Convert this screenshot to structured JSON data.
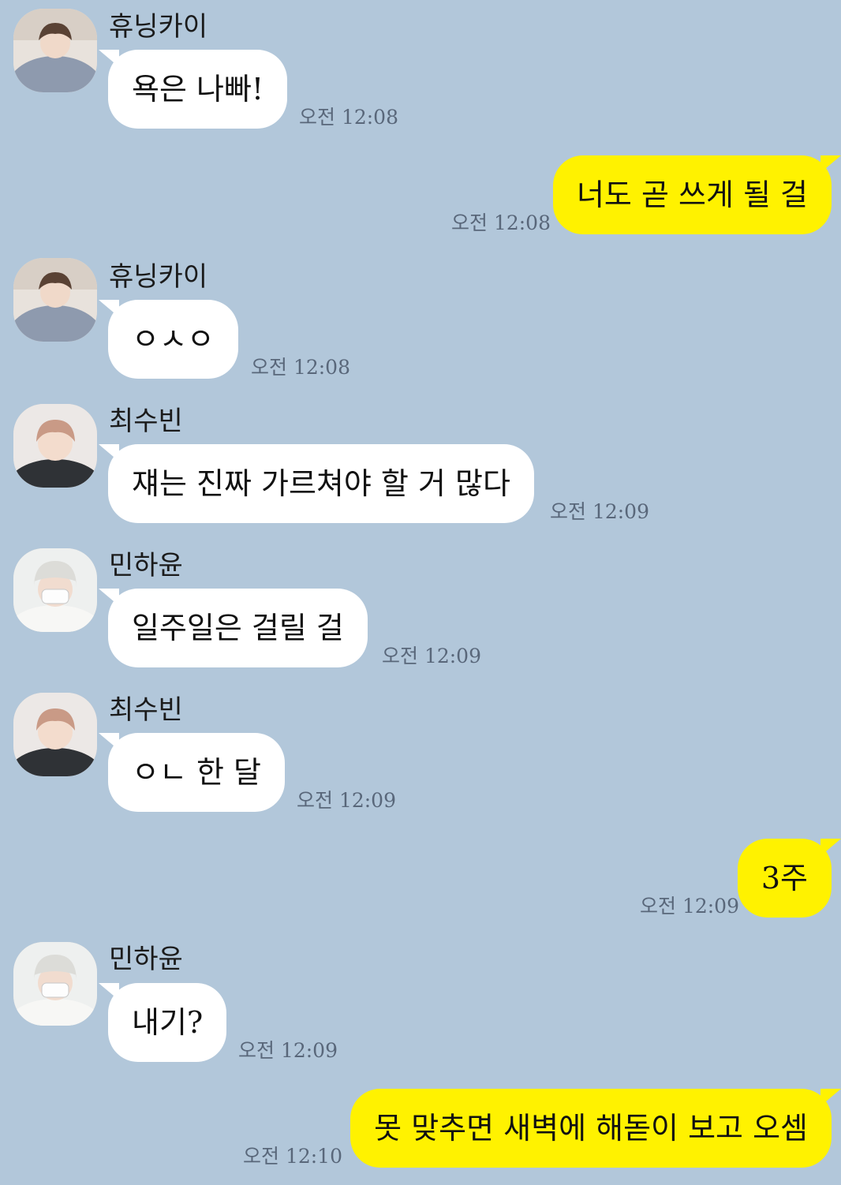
{
  "chat": {
    "messages": [
      {
        "sender": "휴닝카이",
        "text": "욕은 나빠!",
        "time": "오전 12:08",
        "avatar": "avatar-hueningkai"
      },
      {
        "sender": "",
        "text": "너도 곧 쓰게 될 걸",
        "time": "오전 12:08",
        "mine": true
      },
      {
        "sender": "휴닝카이",
        "text": "ㅇㅅㅇ",
        "time": "오전 12:08",
        "avatar": "avatar-hueningkai"
      },
      {
        "sender": "최수빈",
        "text": "쟤는 진짜 가르쳐야 할 거 많다",
        "time": "오전 12:09",
        "avatar": "avatar-soobin"
      },
      {
        "sender": "민하윤",
        "text": "일주일은 걸릴 걸",
        "time": "오전 12:09",
        "avatar": "avatar-hayun"
      },
      {
        "sender": "최수빈",
        "text": "ㅇㄴ 한 달",
        "time": "오전 12:09",
        "avatar": "avatar-soobin"
      },
      {
        "sender": "",
        "text": "3주",
        "time": "오전 12:09",
        "mine": true
      },
      {
        "sender": "민하윤",
        "text": "내기?",
        "time": "오전 12:09",
        "avatar": "avatar-hayun"
      },
      {
        "sender": "",
        "text": "못 맞추면 새벽에 해돋이 보고 오셈",
        "time": "오전 12:10",
        "mine": true
      }
    ]
  },
  "colors": {
    "background": "#b2c7da",
    "incoming_bubble": "#ffffff",
    "outgoing_bubble": "#fff200",
    "time_text": "#59677a"
  }
}
